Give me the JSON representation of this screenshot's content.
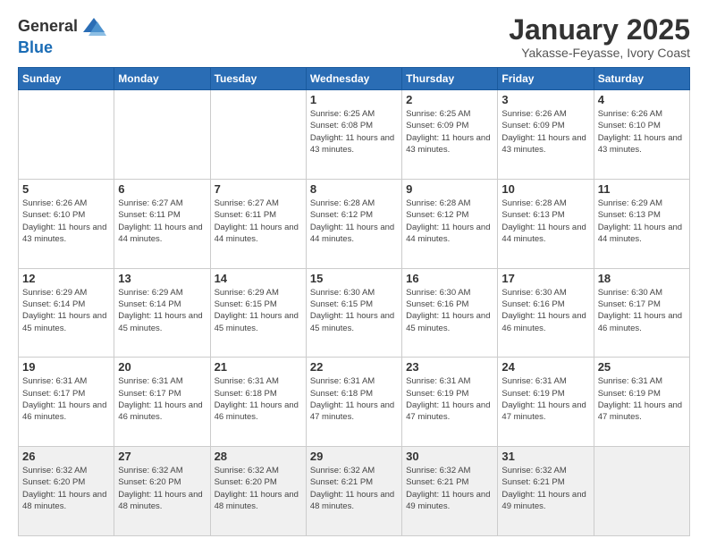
{
  "logo": {
    "general": "General",
    "blue": "Blue"
  },
  "header": {
    "month": "January 2025",
    "location": "Yakasse-Feyasse, Ivory Coast"
  },
  "days_of_week": [
    "Sunday",
    "Monday",
    "Tuesday",
    "Wednesday",
    "Thursday",
    "Friday",
    "Saturday"
  ],
  "weeks": [
    [
      {
        "day": "",
        "info": ""
      },
      {
        "day": "",
        "info": ""
      },
      {
        "day": "",
        "info": ""
      },
      {
        "day": "1",
        "info": "Sunrise: 6:25 AM\nSunset: 6:08 PM\nDaylight: 11 hours and 43 minutes."
      },
      {
        "day": "2",
        "info": "Sunrise: 6:25 AM\nSunset: 6:09 PM\nDaylight: 11 hours and 43 minutes."
      },
      {
        "day": "3",
        "info": "Sunrise: 6:26 AM\nSunset: 6:09 PM\nDaylight: 11 hours and 43 minutes."
      },
      {
        "day": "4",
        "info": "Sunrise: 6:26 AM\nSunset: 6:10 PM\nDaylight: 11 hours and 43 minutes."
      }
    ],
    [
      {
        "day": "5",
        "info": "Sunrise: 6:26 AM\nSunset: 6:10 PM\nDaylight: 11 hours and 43 minutes."
      },
      {
        "day": "6",
        "info": "Sunrise: 6:27 AM\nSunset: 6:11 PM\nDaylight: 11 hours and 44 minutes."
      },
      {
        "day": "7",
        "info": "Sunrise: 6:27 AM\nSunset: 6:11 PM\nDaylight: 11 hours and 44 minutes."
      },
      {
        "day": "8",
        "info": "Sunrise: 6:28 AM\nSunset: 6:12 PM\nDaylight: 11 hours and 44 minutes."
      },
      {
        "day": "9",
        "info": "Sunrise: 6:28 AM\nSunset: 6:12 PM\nDaylight: 11 hours and 44 minutes."
      },
      {
        "day": "10",
        "info": "Sunrise: 6:28 AM\nSunset: 6:13 PM\nDaylight: 11 hours and 44 minutes."
      },
      {
        "day": "11",
        "info": "Sunrise: 6:29 AM\nSunset: 6:13 PM\nDaylight: 11 hours and 44 minutes."
      }
    ],
    [
      {
        "day": "12",
        "info": "Sunrise: 6:29 AM\nSunset: 6:14 PM\nDaylight: 11 hours and 45 minutes."
      },
      {
        "day": "13",
        "info": "Sunrise: 6:29 AM\nSunset: 6:14 PM\nDaylight: 11 hours and 45 minutes."
      },
      {
        "day": "14",
        "info": "Sunrise: 6:29 AM\nSunset: 6:15 PM\nDaylight: 11 hours and 45 minutes."
      },
      {
        "day": "15",
        "info": "Sunrise: 6:30 AM\nSunset: 6:15 PM\nDaylight: 11 hours and 45 minutes."
      },
      {
        "day": "16",
        "info": "Sunrise: 6:30 AM\nSunset: 6:16 PM\nDaylight: 11 hours and 45 minutes."
      },
      {
        "day": "17",
        "info": "Sunrise: 6:30 AM\nSunset: 6:16 PM\nDaylight: 11 hours and 46 minutes."
      },
      {
        "day": "18",
        "info": "Sunrise: 6:30 AM\nSunset: 6:17 PM\nDaylight: 11 hours and 46 minutes."
      }
    ],
    [
      {
        "day": "19",
        "info": "Sunrise: 6:31 AM\nSunset: 6:17 PM\nDaylight: 11 hours and 46 minutes."
      },
      {
        "day": "20",
        "info": "Sunrise: 6:31 AM\nSunset: 6:17 PM\nDaylight: 11 hours and 46 minutes."
      },
      {
        "day": "21",
        "info": "Sunrise: 6:31 AM\nSunset: 6:18 PM\nDaylight: 11 hours and 46 minutes."
      },
      {
        "day": "22",
        "info": "Sunrise: 6:31 AM\nSunset: 6:18 PM\nDaylight: 11 hours and 47 minutes."
      },
      {
        "day": "23",
        "info": "Sunrise: 6:31 AM\nSunset: 6:19 PM\nDaylight: 11 hours and 47 minutes."
      },
      {
        "day": "24",
        "info": "Sunrise: 6:31 AM\nSunset: 6:19 PM\nDaylight: 11 hours and 47 minutes."
      },
      {
        "day": "25",
        "info": "Sunrise: 6:31 AM\nSunset: 6:19 PM\nDaylight: 11 hours and 47 minutes."
      }
    ],
    [
      {
        "day": "26",
        "info": "Sunrise: 6:32 AM\nSunset: 6:20 PM\nDaylight: 11 hours and 48 minutes."
      },
      {
        "day": "27",
        "info": "Sunrise: 6:32 AM\nSunset: 6:20 PM\nDaylight: 11 hours and 48 minutes."
      },
      {
        "day": "28",
        "info": "Sunrise: 6:32 AM\nSunset: 6:20 PM\nDaylight: 11 hours and 48 minutes."
      },
      {
        "day": "29",
        "info": "Sunrise: 6:32 AM\nSunset: 6:21 PM\nDaylight: 11 hours and 48 minutes."
      },
      {
        "day": "30",
        "info": "Sunrise: 6:32 AM\nSunset: 6:21 PM\nDaylight: 11 hours and 49 minutes."
      },
      {
        "day": "31",
        "info": "Sunrise: 6:32 AM\nSunset: 6:21 PM\nDaylight: 11 hours and 49 minutes."
      },
      {
        "day": "",
        "info": ""
      }
    ]
  ]
}
